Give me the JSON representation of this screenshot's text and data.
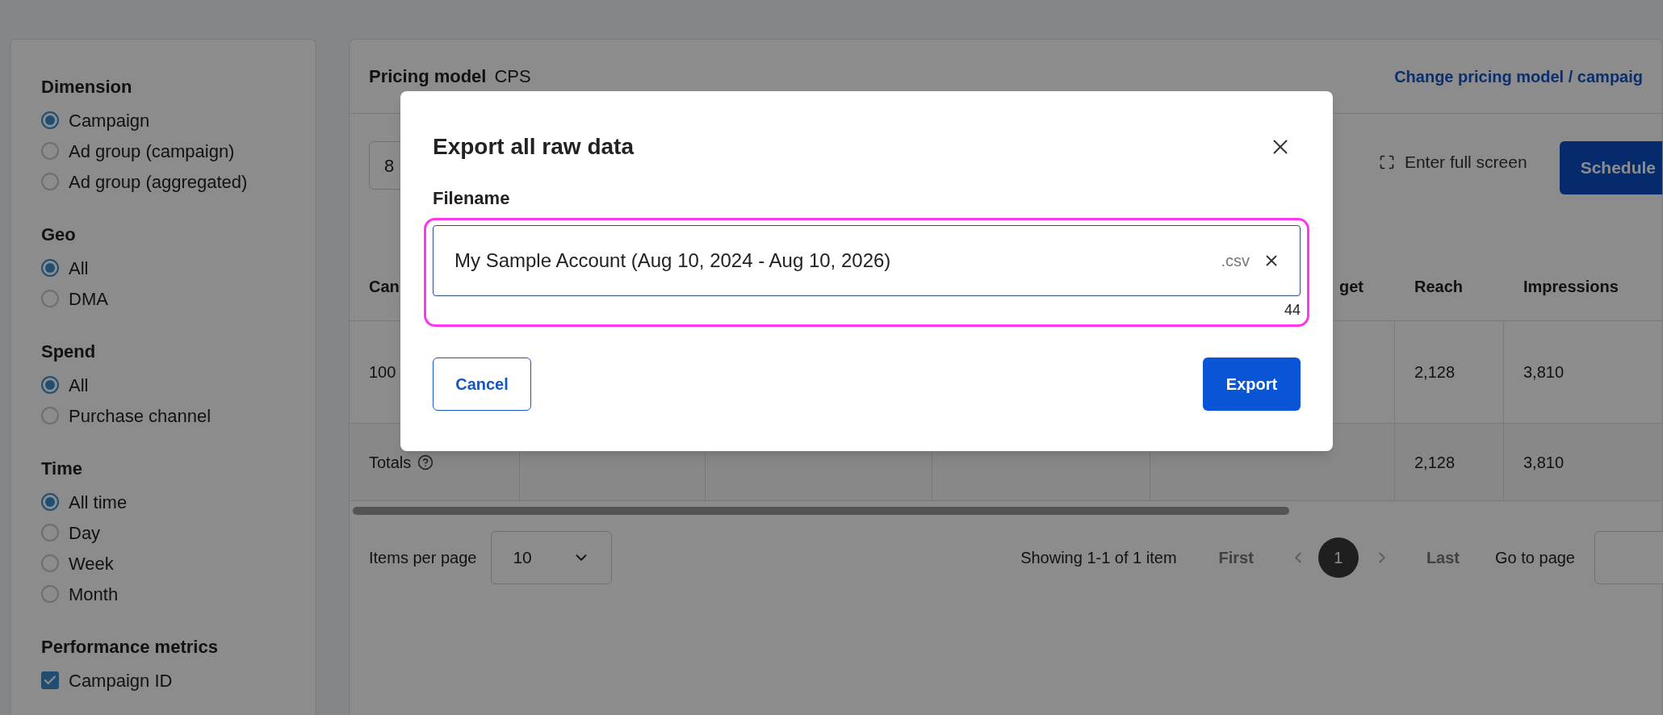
{
  "sidebar": {
    "groups": [
      {
        "title": "Dimension",
        "kind": "radio",
        "options": [
          {
            "label": "Campaign",
            "selected": true
          },
          {
            "label": "Ad group (campaign)",
            "selected": false
          },
          {
            "label": "Ad group (aggregated)",
            "selected": false
          }
        ]
      },
      {
        "title": "Geo",
        "kind": "radio",
        "options": [
          {
            "label": "All",
            "selected": true
          },
          {
            "label": "DMA",
            "selected": false
          }
        ]
      },
      {
        "title": "Spend",
        "kind": "radio",
        "options": [
          {
            "label": "All",
            "selected": true
          },
          {
            "label": "Purchase channel",
            "selected": false
          }
        ]
      },
      {
        "title": "Time",
        "kind": "radio",
        "options": [
          {
            "label": "All time",
            "selected": true
          },
          {
            "label": "Day",
            "selected": false
          },
          {
            "label": "Week",
            "selected": false
          },
          {
            "label": "Month",
            "selected": false
          }
        ]
      },
      {
        "title": "Performance metrics",
        "kind": "checkbox",
        "options": [
          {
            "label": "Campaign ID",
            "checked": true
          }
        ]
      }
    ]
  },
  "header": {
    "label": "Pricing model",
    "value": "CPS",
    "link": "Change pricing model / campaig"
  },
  "toolbar": {
    "field_value": "8",
    "fullscreen": "Enter full screen",
    "schedule": "Schedule"
  },
  "table": {
    "columns": [
      "Can",
      "get",
      "Reach",
      "Impressions"
    ],
    "rows": [
      {
        "kind": "data",
        "cells": [
          "100",
          "",
          "2,128",
          "3,810"
        ]
      },
      {
        "kind": "totals",
        "cells": [
          "Totals",
          "",
          "2,128",
          "3,810"
        ]
      }
    ]
  },
  "pagination": {
    "items_label": "Items per page",
    "page_size": "10",
    "showing": "Showing 1-1 of 1 item",
    "first": "First",
    "pages": [
      {
        "label": "1",
        "selected": true
      }
    ],
    "last": "Last",
    "goto": "Go to page"
  },
  "dialog": {
    "title": "Export all raw data",
    "field_label": "Filename",
    "value": "My Sample Account (Aug 10, 2024 - Aug 10, 2026)",
    "suffix": ".csv",
    "counter": "44",
    "cancel": "Cancel",
    "export": "Export"
  }
}
